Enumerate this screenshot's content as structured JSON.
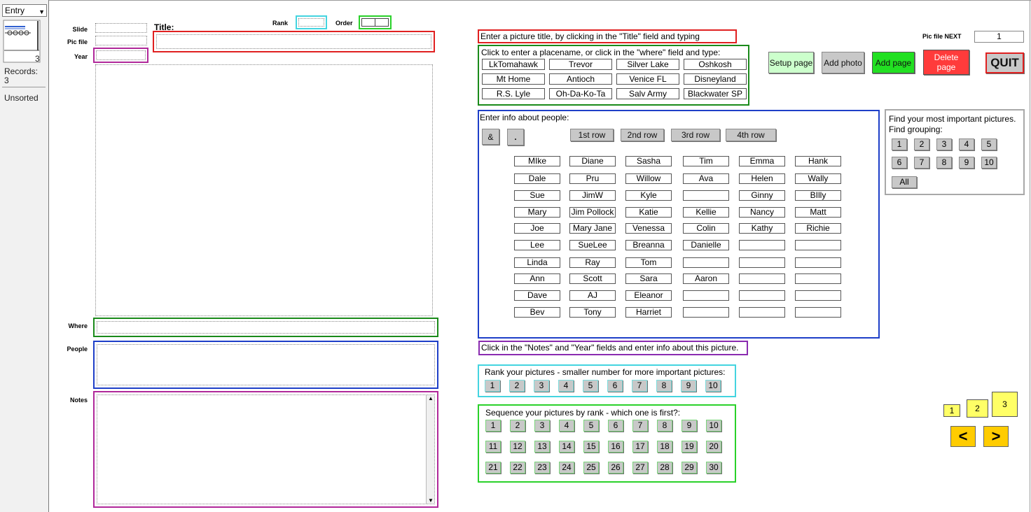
{
  "status": {
    "layout": "Entry",
    "record_number": "3",
    "records_label": "Records:",
    "records_count": "3",
    "sort_status": "Unsorted"
  },
  "fields": {
    "slide_label": "Slide",
    "pic_file_label": "Pic file",
    "year_label": "Year",
    "title_label": "Title:",
    "rank_label": "Rank",
    "order_label": "Order",
    "where_label": "Where",
    "people_label": "People",
    "notes_label": "Notes"
  },
  "pic_file_next": {
    "label": "Pic file NEXT",
    "value": "1"
  },
  "instructions": {
    "title": "Enter a picture title, by clicking in the \"Title\" field and typing",
    "place": "Click to enter a placename, or click in the \"where\" field and type:",
    "people": "Enter info about people:",
    "notes": "Click in the \"Notes\" and \"Year\" fields and enter info about this picture.",
    "rank": "Rank your pictures - smaller number for more important pictures:",
    "sequence": "Sequence your pictures by rank - which one is first?:",
    "find": "Find your most important pictures.",
    "find_grouping": "Find grouping:"
  },
  "places": [
    "LkTomahawk",
    "Trevor",
    "Silver Lake",
    "Oshkosh",
    "Mt Home",
    "Antioch",
    "Venice FL",
    "Disneyland",
    "R.S. Lyle",
    "Oh-Da-Ko-Ta",
    "Salv Army",
    "Blackwater SP"
  ],
  "toolbar": {
    "setup": "Setup page",
    "add_photo": "Add photo",
    "add_page": "Add page",
    "delete_page": "Delete page",
    "quit": "QUIT"
  },
  "people_tools": {
    "amp": "&",
    "dot": ".",
    "rows": [
      "1st row",
      "2nd row",
      "3rd row",
      "4th row"
    ]
  },
  "people": [
    [
      "MIke",
      "Diane",
      "Sasha",
      "Tim",
      "Emma",
      "Hank"
    ],
    [
      "Dale",
      "Pru",
      "Willow",
      "Ava",
      "Helen",
      "Wally"
    ],
    [
      "Sue",
      "JimW",
      "Kyle",
      "",
      "Ginny",
      "BIlly"
    ],
    [
      "Mary",
      "Jim Pollock",
      "Katie",
      "Kellie",
      "Nancy",
      "Matt"
    ],
    [
      "Joe",
      "Mary Jane",
      "Venessa",
      "Colin",
      "Kathy",
      "Richie"
    ],
    [
      "Lee",
      "SueLee",
      "Breanna",
      "Danielle",
      "",
      ""
    ],
    [
      "Linda",
      "Ray",
      "Tom",
      "",
      "",
      ""
    ],
    [
      "Ann",
      "Scott",
      "Sara",
      "Aaron",
      "",
      ""
    ],
    [
      "Dave",
      "AJ",
      "Eleanor",
      "",
      "",
      ""
    ],
    [
      "Bev",
      "Tony",
      "Harriet",
      "",
      "",
      ""
    ]
  ],
  "rank_numbers": [
    "1",
    "2",
    "3",
    "4",
    "5",
    "6",
    "7",
    "8",
    "9",
    "10"
  ],
  "sequence_numbers": [
    "1",
    "2",
    "3",
    "4",
    "5",
    "6",
    "7",
    "8",
    "9",
    "10",
    "11",
    "12",
    "13",
    "14",
    "15",
    "16",
    "17",
    "18",
    "19",
    "20",
    "21",
    "22",
    "23",
    "24",
    "25",
    "26",
    "27",
    "28",
    "29",
    "30"
  ],
  "find_numbers": [
    "1",
    "2",
    "3",
    "4",
    "5",
    "6",
    "7",
    "8",
    "9",
    "10"
  ],
  "find_all": "All",
  "page_buttons": [
    "1",
    "2",
    "3"
  ],
  "nav": {
    "prev": "<",
    "next": ">"
  },
  "colors": {
    "red": "#e02020",
    "green": "#1a8a1a",
    "blue": "#1e3fc8",
    "magenta": "#b0289a",
    "purple": "#8a2bb0",
    "cyan": "#44d4e0",
    "bright_green": "#2ad12a",
    "gray": "#a8a8a8"
  }
}
